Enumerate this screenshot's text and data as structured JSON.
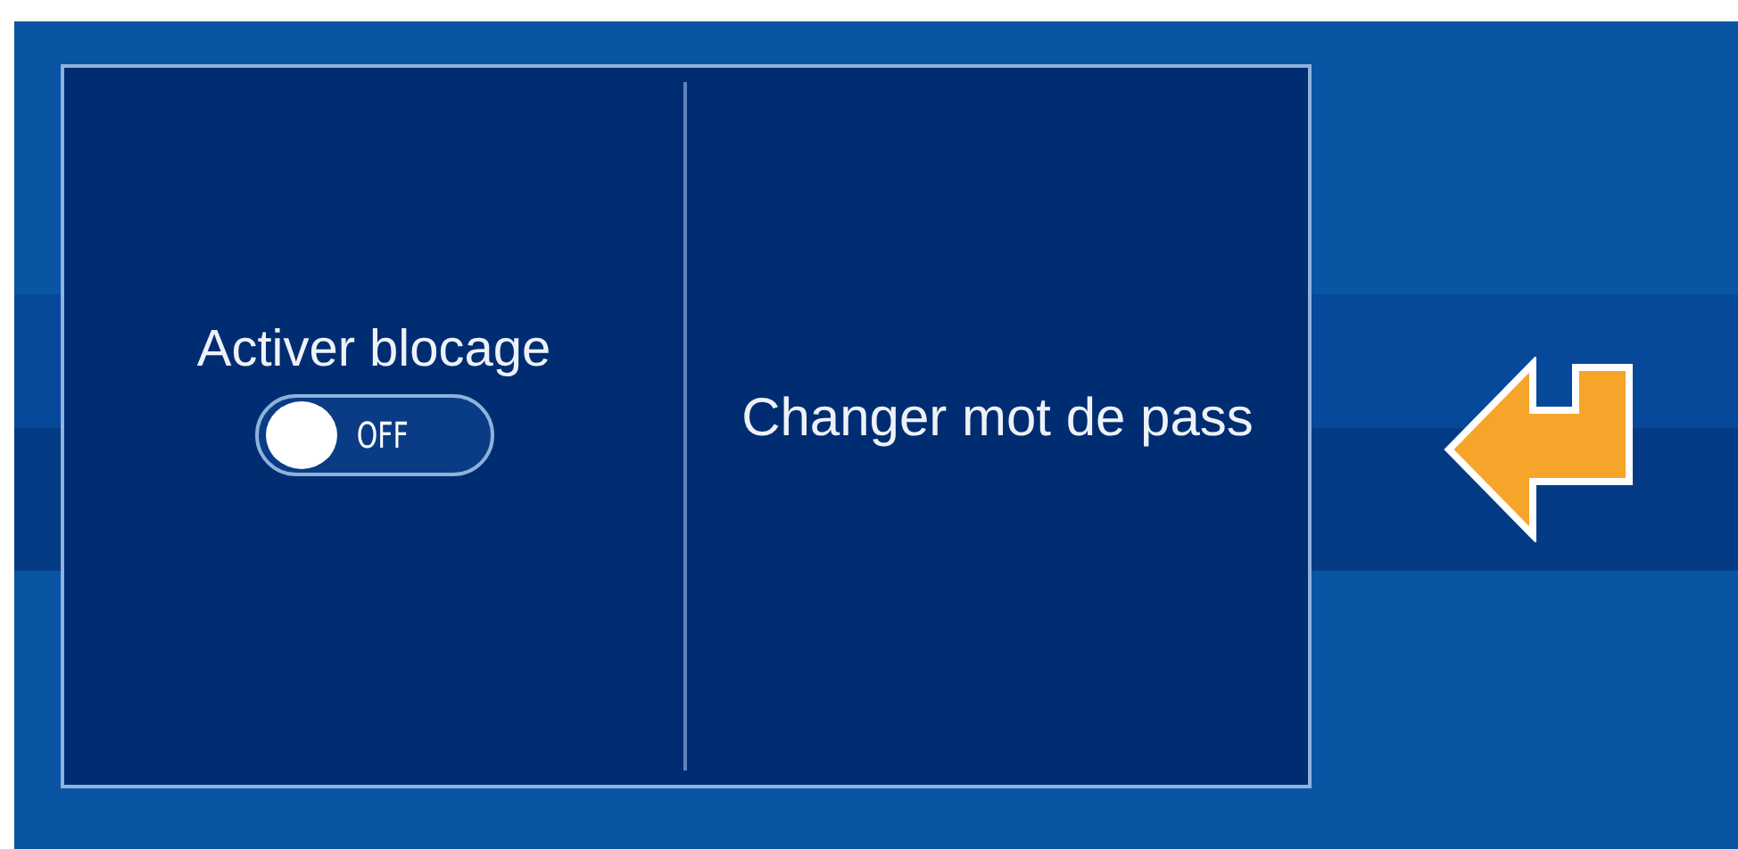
{
  "lock_panel": {
    "toggle_label": "Activer blocage",
    "toggle": {
      "on": false,
      "text": "OFF"
    },
    "change_password": "Changer mot de pass"
  },
  "back_button": {
    "kind": "return"
  }
}
